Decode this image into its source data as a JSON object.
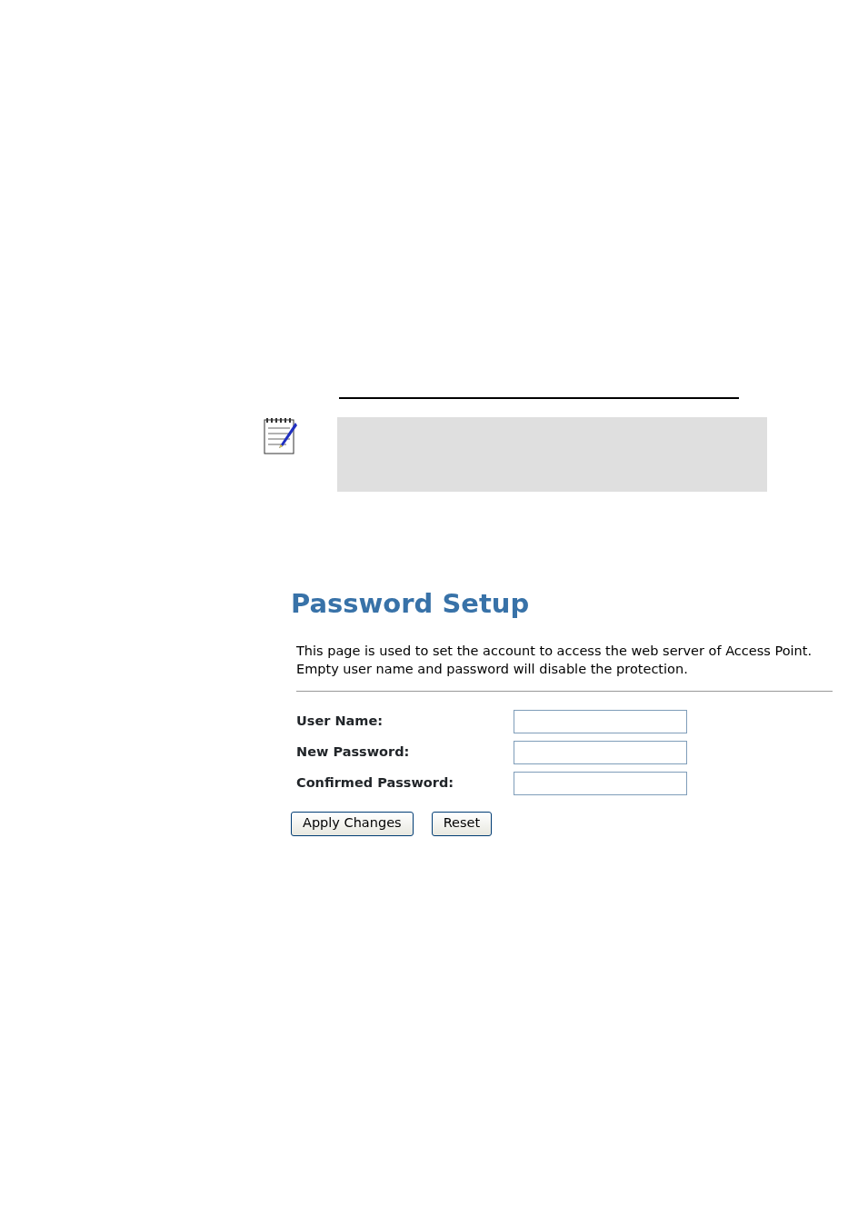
{
  "title": "Password Setup",
  "description": "This page is used to set the account to access the web server of Access Point. Empty user name and password will disable the protection.",
  "fields": [
    {
      "label": "User Name:"
    },
    {
      "label": "New Password:"
    },
    {
      "label": "Confirmed Password:"
    }
  ],
  "buttons": [
    "Apply Changes",
    "Reset"
  ]
}
